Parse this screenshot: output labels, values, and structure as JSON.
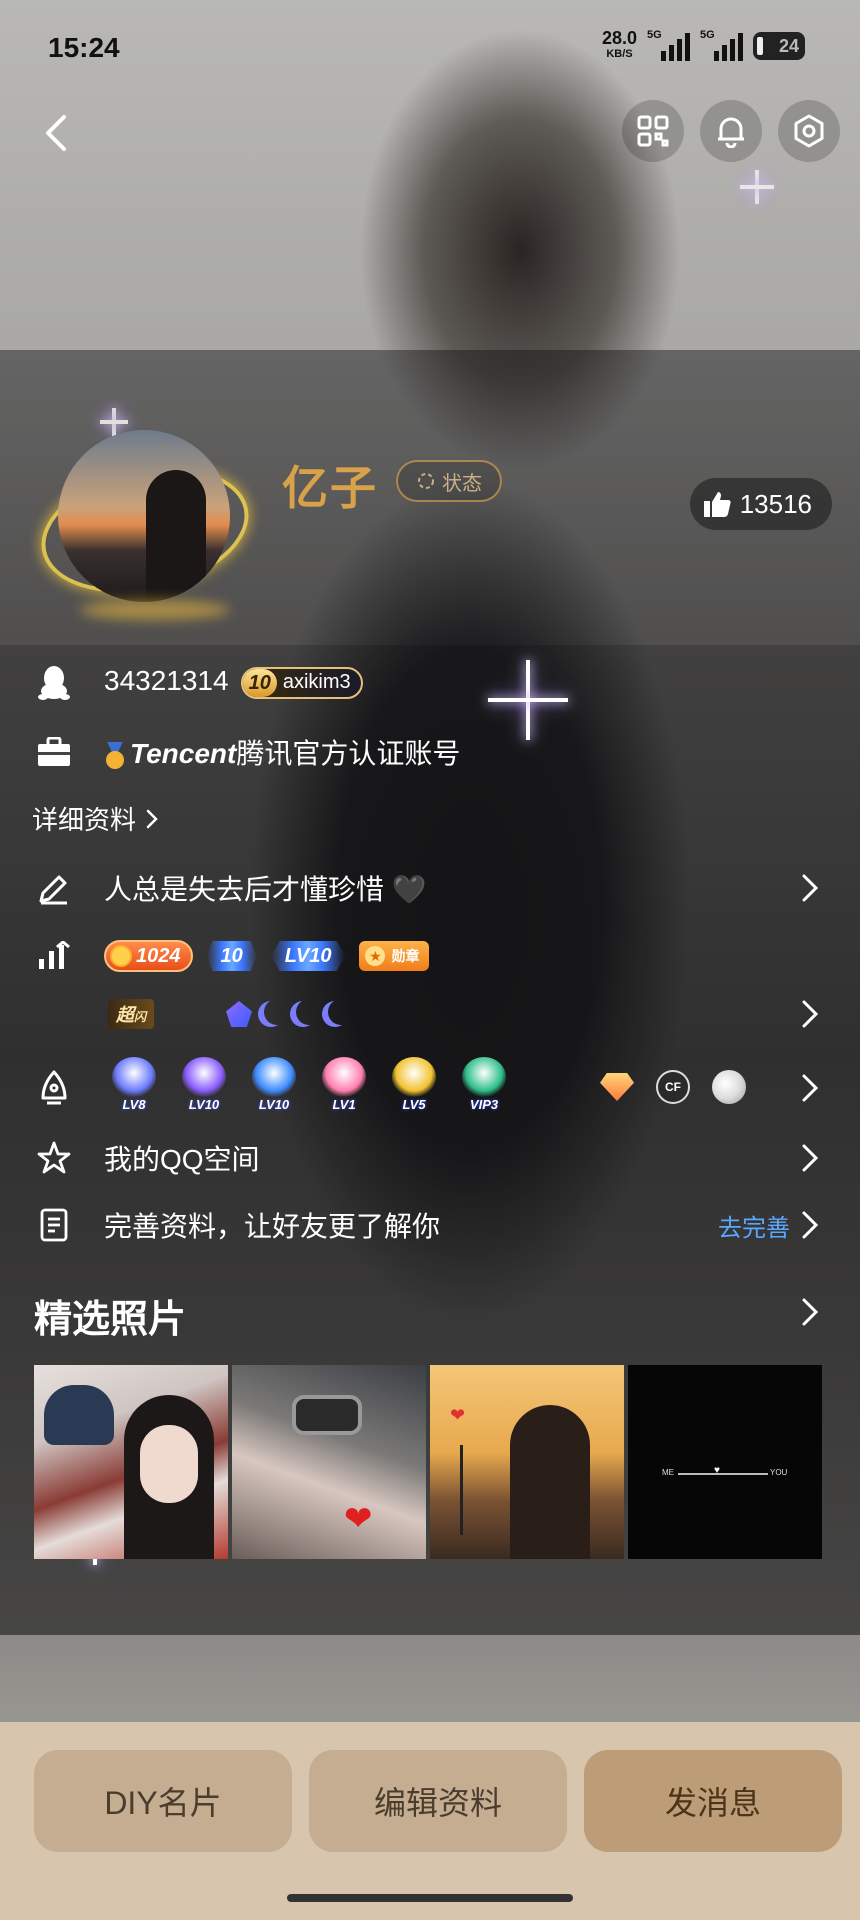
{
  "status_bar": {
    "time": "15:24",
    "net_speed": "28.0",
    "net_unit": "KB/S",
    "sim1": "5G",
    "sim2": "5G",
    "battery": "24"
  },
  "profile": {
    "nickname": "亿子",
    "status_label": "状态",
    "likes": "13516",
    "qq_number": "34321314",
    "qq_level": "10",
    "qq_level_name": "axikim3",
    "cert_brand": "Tencent",
    "cert_text": "腾讯官方认证账号",
    "detail_link": "详细资料",
    "signature": "人总是失去后才懂珍惜 🖤"
  },
  "badges": {
    "coin": "1024",
    "wing1": "10",
    "wing2": "LV10",
    "medal": "勋章",
    "rank_prefix": "超",
    "rank_small": "闪"
  },
  "level_icons": [
    {
      "name": "lv-8-icon",
      "label": "LV8",
      "color": "#6c7bff"
    },
    {
      "name": "lv-10-x-icon",
      "label": "LV10",
      "color": "#8a5cff"
    },
    {
      "name": "lv-10-star-icon",
      "label": "LV10",
      "color": "#3d8bff"
    },
    {
      "name": "lv-1-heart-icon",
      "label": "LV1",
      "color": "#ff7fb0"
    },
    {
      "name": "lv-5-diamond-icon",
      "label": "LV5",
      "color": "#f2c230"
    },
    {
      "name": "vip-3-icon",
      "label": "VIP3",
      "color": "#2fbf8a"
    }
  ],
  "menu": {
    "qzone": "我的QQ空间",
    "complete_profile": "完善资料，让好友更了解你",
    "complete_action": "去完善"
  },
  "photos": {
    "title": "精选照片",
    "p4_me": "ME",
    "p4_you": "YOU"
  },
  "buttons": {
    "diy": "DIY名片",
    "edit": "编辑资料",
    "message": "发消息"
  }
}
